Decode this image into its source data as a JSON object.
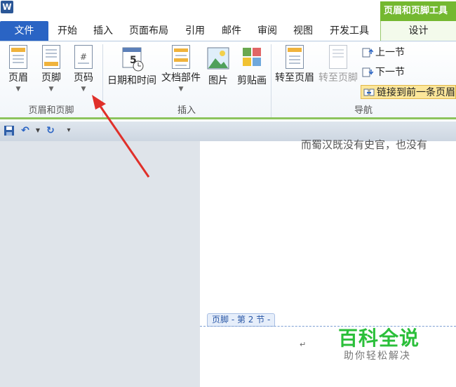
{
  "app": {
    "logo": "W"
  },
  "context_tab_group": {
    "title": "页眉和页脚工具"
  },
  "tabs": [
    "文件",
    "开始",
    "插入",
    "页面布局",
    "引用",
    "邮件",
    "审阅",
    "视图",
    "开发工具"
  ],
  "context_tab": "设计",
  "ribbon": {
    "groups": {
      "header_footer": {
        "label": "页眉和页脚",
        "buttons": [
          {
            "label": "页眉"
          },
          {
            "label": "页脚"
          },
          {
            "label": "页码"
          }
        ]
      },
      "insert": {
        "label": "插入",
        "buttons": [
          {
            "label": "日期和时间"
          },
          {
            "label": "文档部件"
          },
          {
            "label": "图片"
          },
          {
            "label": "剪贴画"
          }
        ],
        "calendar_number": "5"
      },
      "navigation": {
        "label": "导航",
        "goto_header": "转至页眉",
        "goto_footer": "转至页脚",
        "prev_section": "上一节",
        "next_section": "下一节",
        "link_to_previous": "链接到前一条页眉"
      }
    }
  },
  "document": {
    "body_text": "而蜀汉既没有史官，也没有",
    "footer_label": "页脚 - 第 2 节 -",
    "paragraph_mark": "↵"
  },
  "watermark": {
    "main": "百科全说",
    "sub": "助你轻松解决"
  },
  "colors": {
    "accent_green": "#74b830",
    "file_tab_blue": "#2a64c4",
    "annotation_red": "#e0302a"
  }
}
